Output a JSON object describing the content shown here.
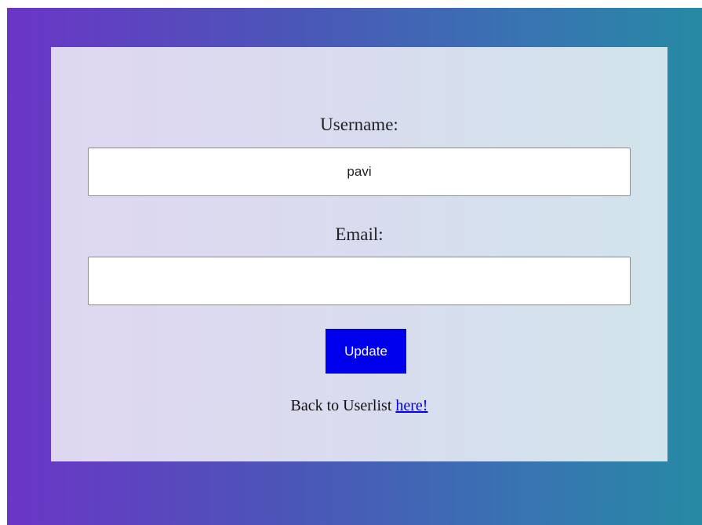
{
  "form": {
    "username_label": "Username:",
    "username_value": "pavi",
    "email_label": "Email:",
    "email_value": "",
    "update_button": "Update",
    "back_text": "Back to Userlist ",
    "back_link": "here!"
  },
  "colors": {
    "background_gradient_start": "#6a36c6",
    "background_gradient_end": "#268aa4",
    "button": "#0000ee",
    "link": "#0000ee"
  }
}
